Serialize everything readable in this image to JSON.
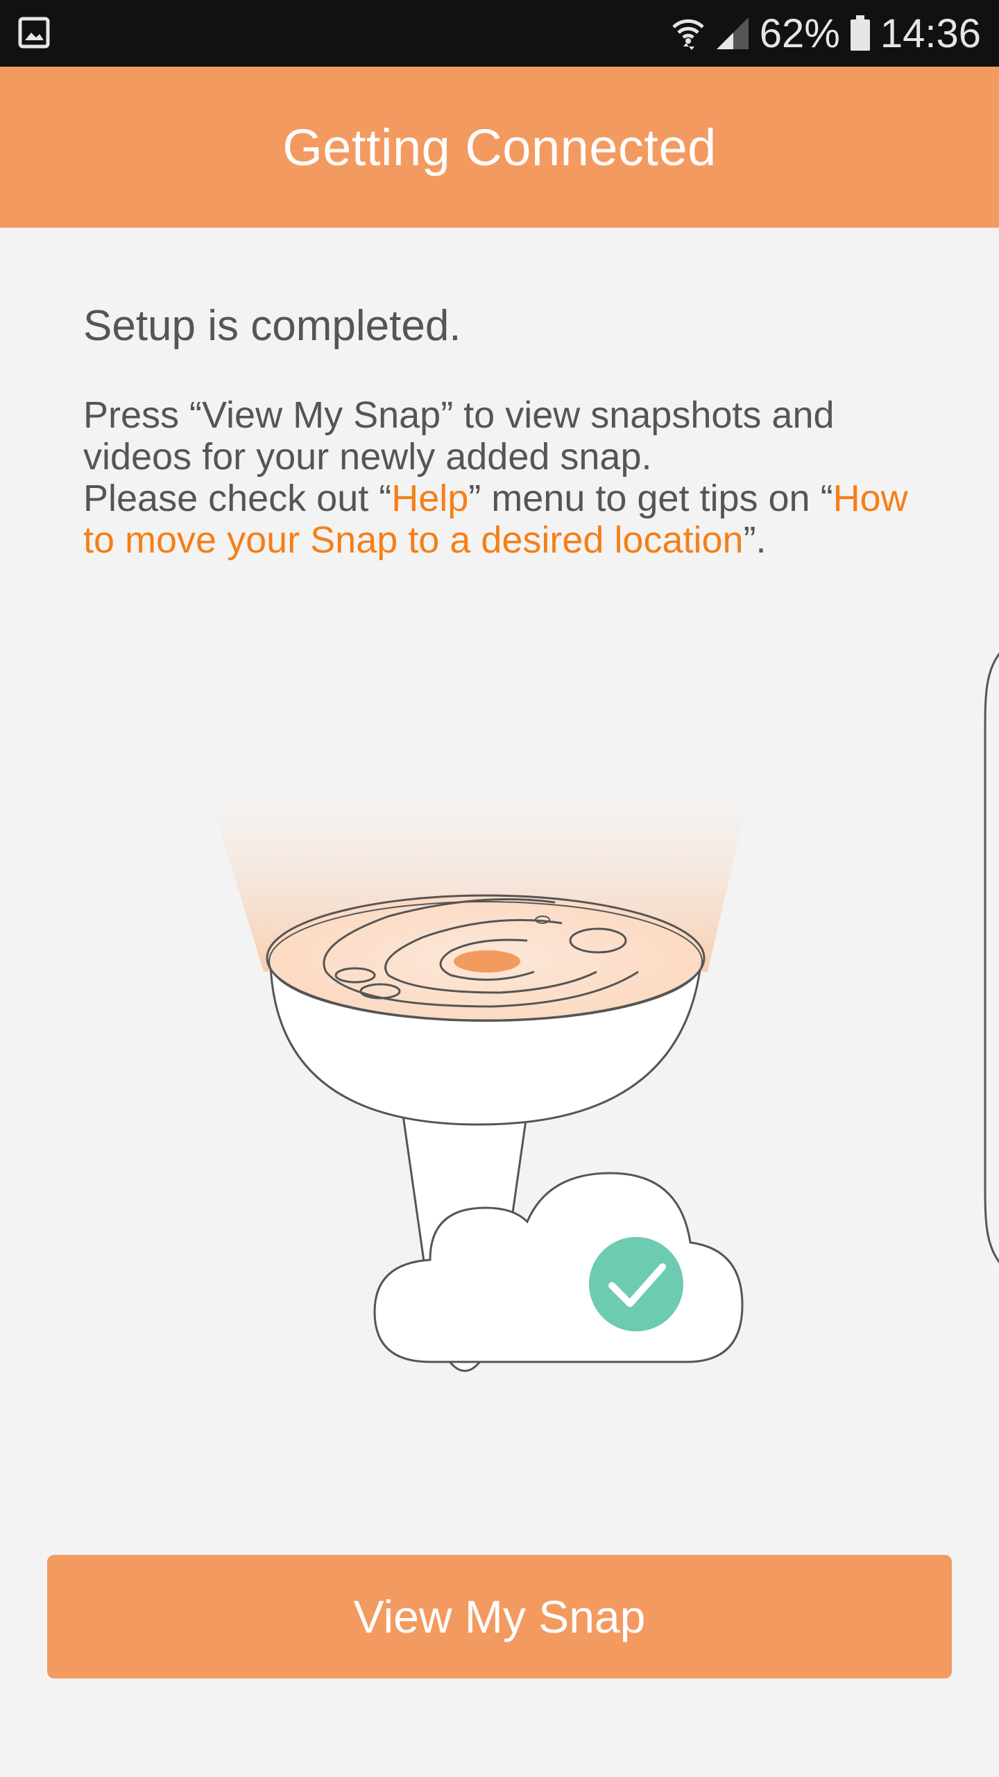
{
  "status_bar": {
    "battery_percent": "62%",
    "time": "14:36",
    "icons": [
      "gallery-icon",
      "wifi-icon",
      "signal-icon",
      "battery-icon"
    ]
  },
  "header": {
    "title": "Getting Connected"
  },
  "main": {
    "heading": "Setup is completed.",
    "line1": "Press “View My Snap” to view snapshots and videos for your newly added snap.",
    "line2_prefix": "Please check out “",
    "help_link": "Help",
    "line2_middle": "” menu to get tips on “",
    "howto_link": "How to move your Snap to a desired location",
    "line2_suffix": "”."
  },
  "illustration": {
    "icons": [
      "snap-bulb-camera-icon",
      "cloud-icon",
      "checkmark-icon"
    ]
  },
  "footer": {
    "button_label": "View My Snap"
  },
  "colors": {
    "accent": "#f39a60",
    "link": "#f57f17",
    "success": "#6ccbb0",
    "status_bar": "#111111"
  }
}
